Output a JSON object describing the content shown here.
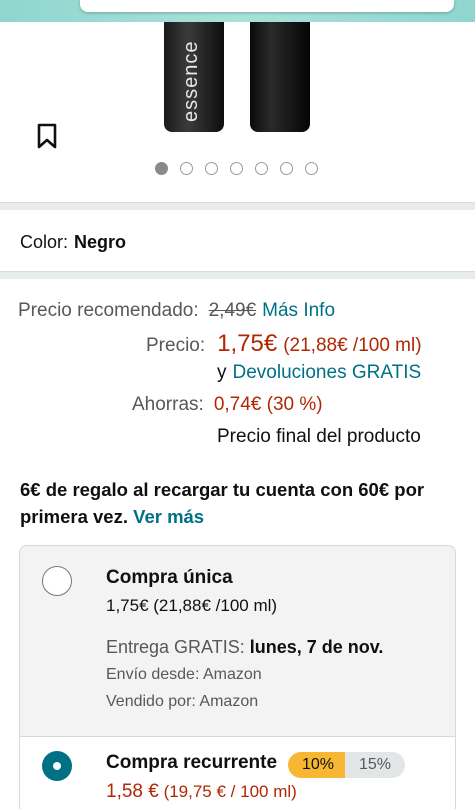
{
  "product": {
    "tube_brand_text": "essence",
    "image_dots_total": 7,
    "image_dots_active": 1
  },
  "color": {
    "label": "Color:",
    "value": "Negro"
  },
  "pricing": {
    "recommended_label": "Precio recomendado:",
    "recommended_value": "2,49€",
    "more_info_link": "Más Info",
    "price_label": "Precio:",
    "price_value": "1,75€",
    "price_unit": "(21,88€ /100 ml)",
    "returns_prefix": "y",
    "returns_link": "Devoluciones GRATIS",
    "savings_label": "Ahorras:",
    "savings_value": "0,74€ (30 %)",
    "final_price_note": "Precio final del producto"
  },
  "promo": {
    "text": "6€ de regalo al recargar tu cuenta con 60€ por primera vez.",
    "link": "Ver más"
  },
  "purchase_options": {
    "one_time": {
      "title": "Compra única",
      "price": "1,75€ (21,88€ /100 ml)",
      "delivery_prefix": "Entrega GRATIS:",
      "delivery_date": "lunes, 7 de nov.",
      "ships_from": "Envío desde: Amazon",
      "sold_by": "Vendido por: Amazon",
      "selected": false
    },
    "recurring": {
      "title": "Compra recurrente",
      "discount_selected": "10%",
      "discount_other": "15%",
      "price": "1,58 €",
      "unit": "(19,75 € / 100 ml)",
      "selected": true
    }
  },
  "colors": {
    "link": "#007185",
    "price_red": "#b12704",
    "pill_orange": "#f7b733",
    "radio_selected": "#007185"
  }
}
